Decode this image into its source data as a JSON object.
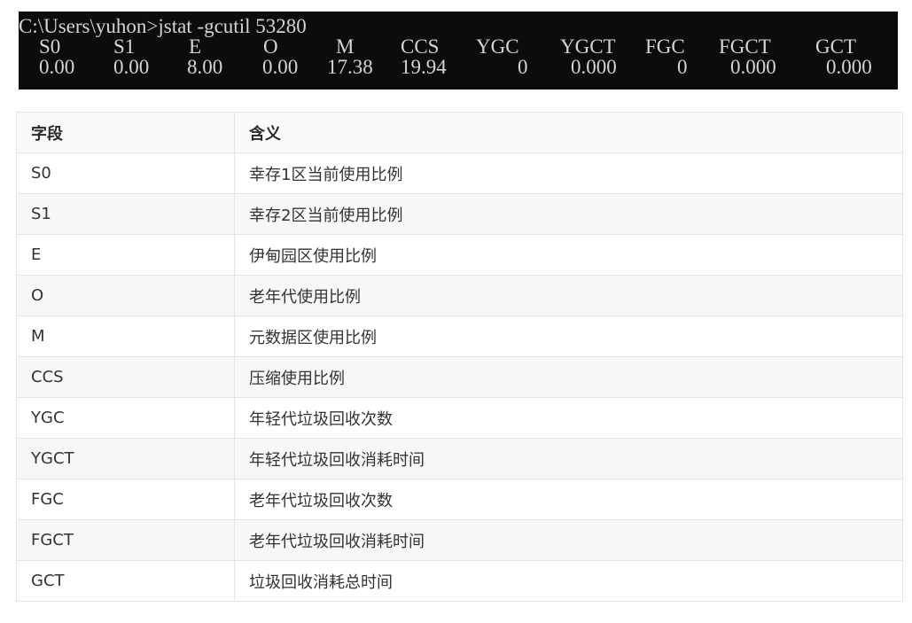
{
  "console": {
    "command_line": "C:\\Users\\yuhon>jstat -gcutil 53280",
    "headers": [
      "S0",
      "S1",
      "E",
      "O",
      "M",
      "CCS",
      "YGC",
      "YGCT",
      "FGC",
      "FGCT",
      "GCT"
    ],
    "values": [
      "0.00",
      "0.00",
      "8.00",
      "0.00",
      "17.38",
      "19.94",
      "0",
      "0.000",
      "0",
      "0.000",
      "0.000"
    ]
  },
  "table": {
    "headers": [
      "字段",
      "含义"
    ],
    "rows": [
      [
        "S0",
        "幸存1区当前使用比例"
      ],
      [
        "S1",
        "幸存2区当前使用比例"
      ],
      [
        "E",
        "伊甸园区使用比例"
      ],
      [
        "O",
        "老年代使用比例"
      ],
      [
        "M",
        "元数据区使用比例"
      ],
      [
        "CCS",
        "压缩使用比例"
      ],
      [
        "YGC",
        "年轻代垃圾回收次数"
      ],
      [
        "YGCT",
        "年轻代垃圾回收消耗时间"
      ],
      [
        "FGC",
        "老年代垃圾回收次数"
      ],
      [
        "FGCT",
        "老年代垃圾回收消耗时间"
      ],
      [
        "GCT",
        "垃圾回收消耗总时间"
      ]
    ]
  }
}
